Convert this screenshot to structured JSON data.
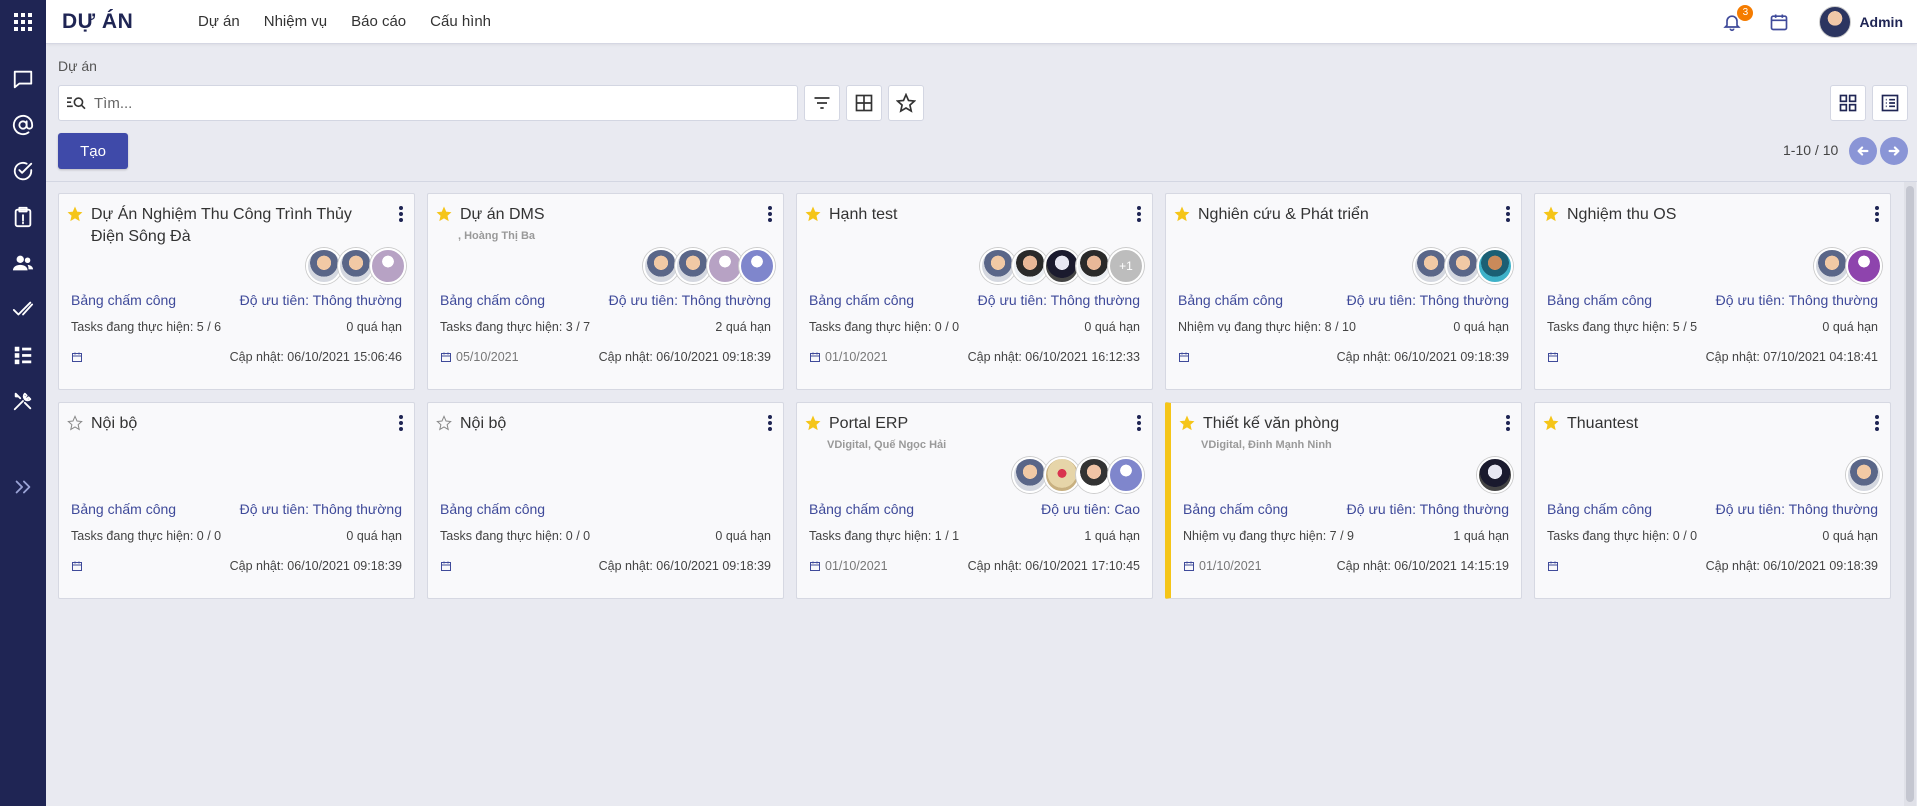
{
  "app": {
    "title": "DỰ ÁN"
  },
  "menu": [
    "Dự án",
    "Nhiệm vụ",
    "Báo cáo",
    "Cấu hình"
  ],
  "topbar": {
    "notification_count": "3",
    "user_name": "Admin"
  },
  "breadcrumb": "Dự án",
  "search": {
    "placeholder": "Tìm..."
  },
  "create_label": "Tạo",
  "pager": "1-10 / 10",
  "labels": {
    "timesheet": "Bảng chấm công",
    "priority_key": "Độ ưu tiên:",
    "updated_prefix": "Cập nhật: "
  },
  "cards": [
    {
      "title": "Dự Án Nghiệm Thu Công Trình Thủy Điện Sông Đà",
      "subtitle": "",
      "starred": true,
      "priority": "Thông thường",
      "tasks": "Tasks đang thực hiện: 5 / 6",
      "overdue": "0 quá hạn",
      "date": "",
      "updated": "06/10/2021 15:06:46",
      "avatars": [
        "av-a",
        "av-a",
        "av-c"
      ]
    },
    {
      "title": "Dự án DMS",
      "subtitle": ", Hoàng Thị Ba",
      "starred": true,
      "priority": "Thông thường",
      "tasks": "Tasks đang thực hiện: 3 / 7",
      "overdue": "2 quá hạn",
      "date": "05/10/2021",
      "updated": "06/10/2021 09:18:39",
      "avatars": [
        "av-a",
        "av-a",
        "av-c",
        "av-d"
      ]
    },
    {
      "title": "Hạnh test",
      "subtitle": "",
      "starred": true,
      "priority": "Thông thường",
      "tasks": "Tasks đang thực hiện: 0 / 0",
      "overdue": "0 quá hạn",
      "date": "01/10/2021",
      "updated": "06/10/2021 16:12:33",
      "avatars": [
        "av-a",
        "av-b",
        "av-h",
        "av-b"
      ],
      "more": "+1"
    },
    {
      "title": "Nghiên cứu & Phát triển",
      "subtitle": "",
      "starred": true,
      "priority": "Thông thường",
      "tasks": "Nhiệm vụ đang thực hiện: 8 / 10",
      "overdue": "0 quá hạn",
      "date": "",
      "updated": "06/10/2021 09:18:39",
      "avatars": [
        "av-a",
        "av-a",
        "av-f"
      ]
    },
    {
      "title": "Nghiệm thu OS",
      "subtitle": "",
      "starred": true,
      "priority": "Thông thường",
      "tasks": "Tasks đang thực hiện: 5 / 5",
      "overdue": "0 quá hạn",
      "date": "",
      "updated": "07/10/2021 04:18:41",
      "avatars": [
        "av-a",
        "av-e"
      ]
    },
    {
      "title": "Nội bộ",
      "subtitle": "",
      "starred": false,
      "priority": "Thông thường",
      "tasks": "Tasks đang thực hiện: 0 / 0",
      "overdue": "0 quá hạn",
      "date": "",
      "updated": "06/10/2021 09:18:39",
      "avatars": []
    },
    {
      "title": "Nội bộ",
      "subtitle": "",
      "starred": false,
      "priority": "",
      "tasks": "Tasks đang thực hiện: 0 / 0",
      "overdue": "0 quá hạn",
      "date": "",
      "updated": "06/10/2021 09:18:39",
      "avatars": []
    },
    {
      "title": "Portal ERP",
      "subtitle": "VDigital, Quế Ngọc Hải",
      "starred": true,
      "priority": "Cao",
      "tasks": "Tasks đang thực hiện: 1 / 1",
      "overdue": "1 quá hạn",
      "date": "01/10/2021",
      "updated": "06/10/2021 17:10:45",
      "avatars": [
        "av-a",
        "av-g",
        "av-i",
        "av-d"
      ]
    },
    {
      "title": "Thiết kế văn phòng",
      "subtitle": "VDigital, Đinh Mạnh Ninh",
      "starred": true,
      "priority": "Thông thường",
      "tasks": "Nhiệm vụ đang thực hiện: 7 / 9",
      "overdue": "1 quá hạn",
      "date": "01/10/2021",
      "updated": "06/10/2021 14:15:19",
      "avatars": [
        "av-h"
      ],
      "bar": true
    },
    {
      "title": "Thuantest",
      "subtitle": "",
      "starred": true,
      "priority": "Thông thường",
      "tasks": "Tasks đang thực hiện: 0 / 0",
      "overdue": "0 quá hạn",
      "date": "",
      "updated": "06/10/2021 09:18:39",
      "avatars": [
        "av-a"
      ]
    }
  ],
  "icons": {
    "sidebar": [
      "apps-icon",
      "chat-icon",
      "at-icon",
      "check-circle-icon",
      "clipboard-icon",
      "users-icon",
      "double-check-icon",
      "checklist-icon",
      "tools-icon",
      "expand-icon"
    ],
    "accent": "#3f4aa9",
    "sidebar_bg": "#1f2554",
    "star": "#f5c518"
  }
}
